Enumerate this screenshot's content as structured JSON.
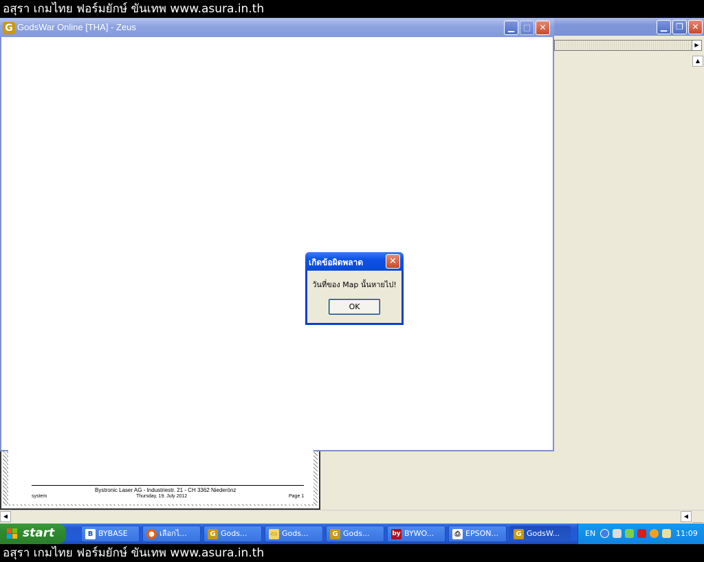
{
  "banner": {
    "text": "อสุรา เกมไทย ฟอร์มยักษ์ ขันเทพ www.asura.in.th"
  },
  "game_window": {
    "title": "GodsWar Online [THA] - Zeus",
    "icon": "godswar-icon"
  },
  "dialog": {
    "title": "เกิดข้อผิดพลาด",
    "message": "วันที่ของ Map นั้นหายไป!",
    "ok_label": "OK"
  },
  "document": {
    "company_line": "Bystronic Laser AG - Industriestr. 21 - CH 3362 Niederönz",
    "left_footer": "system",
    "date": "Thursday, 19. July 2012",
    "page_label": "Page 1"
  },
  "taskbar": {
    "start_label": "start",
    "items": [
      {
        "label": "BYBASE",
        "icon": "bybase-icon"
      },
      {
        "label": "เลือกไ...",
        "icon": "firefox-icon"
      },
      {
        "label": "Gods...",
        "icon": "godswar-icon"
      },
      {
        "label": "Gods...",
        "icon": "folder-icon"
      },
      {
        "label": "Gods...",
        "icon": "godswar-icon"
      },
      {
        "label": "BYWO...",
        "icon": "bywork-icon"
      },
      {
        "label": "EPSON...",
        "icon": "printer-icon"
      },
      {
        "label": "GodsW...",
        "icon": "godswar-icon",
        "active": true
      }
    ],
    "tray": {
      "language": "EN",
      "clock": "11:09"
    }
  },
  "colors": {
    "xp_blue": "#0a49d6",
    "start_green": "#2f8a2f",
    "desktop_bg": "#ece9d8"
  }
}
